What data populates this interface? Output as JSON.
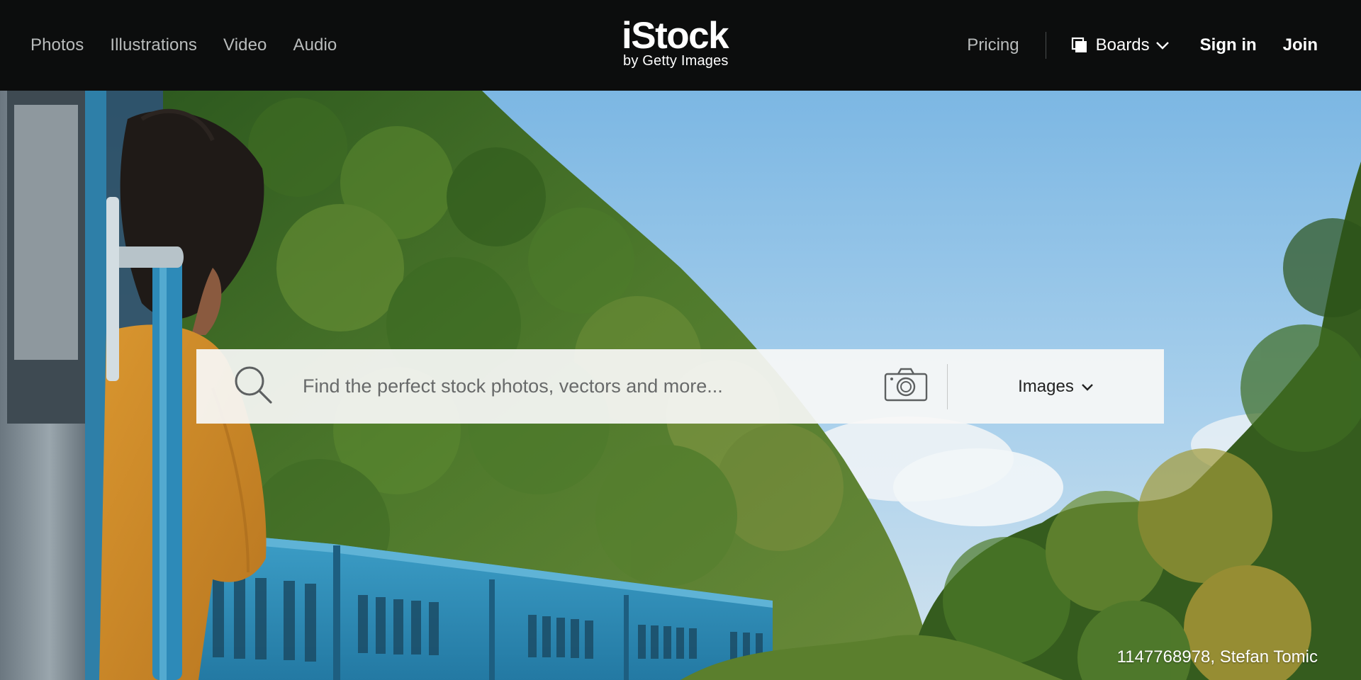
{
  "header": {
    "nav_left": [
      {
        "label": "Photos"
      },
      {
        "label": "Illustrations"
      },
      {
        "label": "Video"
      },
      {
        "label": "Audio"
      }
    ],
    "logo": {
      "main": "iStock",
      "sub": "by Getty Images"
    },
    "pricing_label": "Pricing",
    "boards_label": "Boards",
    "signin_label": "Sign in",
    "join_label": "Join"
  },
  "search": {
    "placeholder": "Find the perfect stock photos, vectors and more...",
    "value": "",
    "type_label": "Images"
  },
  "hero": {
    "credit": "1147768978, Stefan Tomic"
  },
  "colors": {
    "header_bg": "#0c0d0d",
    "nav_muted": "#b9bcbc",
    "nav_active": "#ffffff"
  },
  "icons": {
    "search": "search-icon",
    "camera": "camera-icon",
    "boards": "boards-icon",
    "chevron": "chevron-down-icon"
  }
}
